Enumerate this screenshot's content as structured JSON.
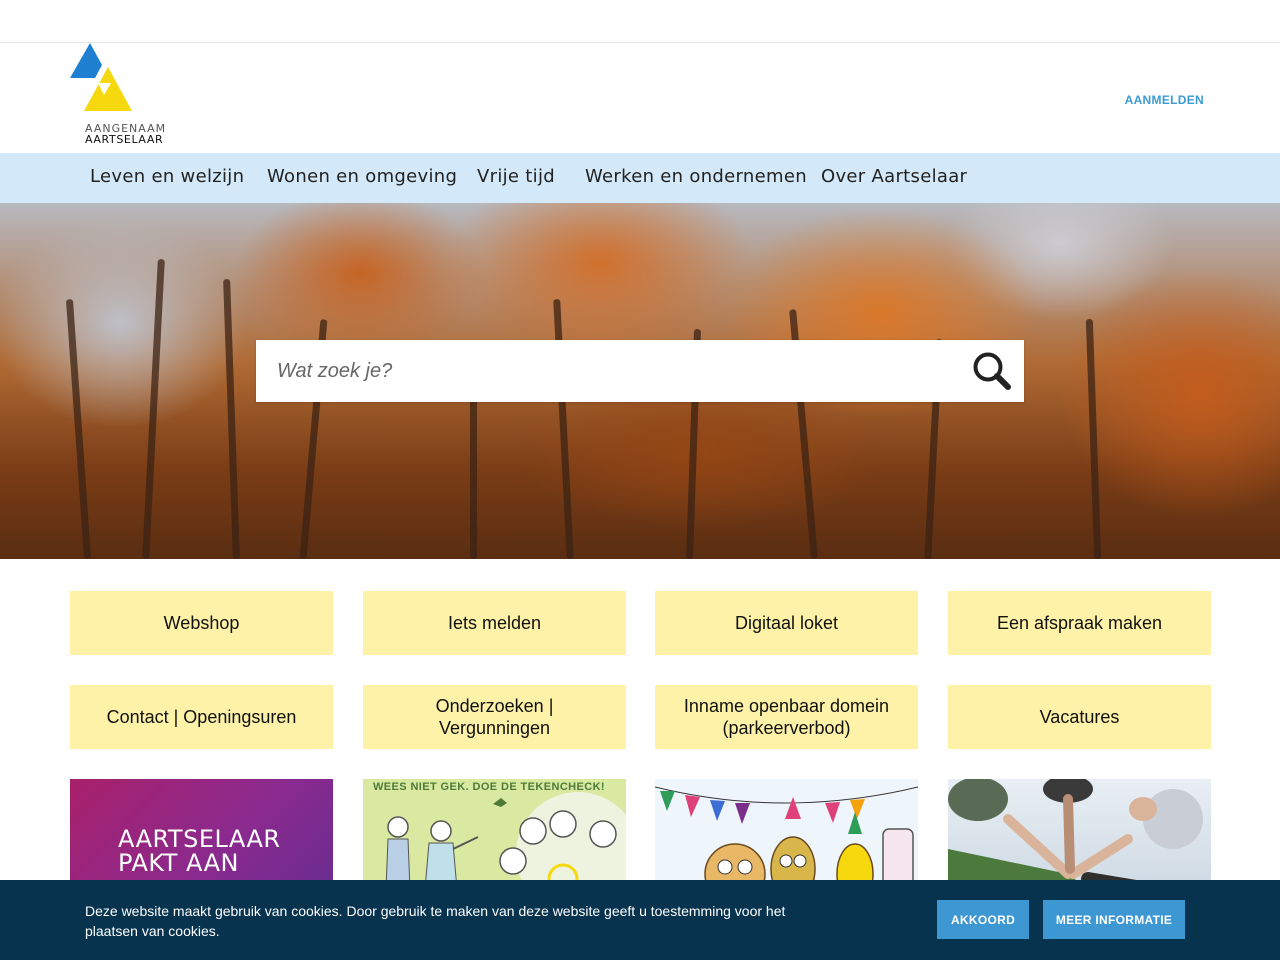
{
  "header": {
    "logo_line1": "AANGENAAM",
    "logo_line2": "AARTSELAAR",
    "login_label": "AANMELDEN"
  },
  "nav": {
    "items": [
      {
        "label": "Leven en welzijn"
      },
      {
        "label": "Wonen en omgeving"
      },
      {
        "label": "Vrije tijd"
      },
      {
        "label": "Werken en ondernemen"
      },
      {
        "label": "Over Aartselaar"
      }
    ]
  },
  "search": {
    "placeholder": "Wat zoek je?",
    "value": "",
    "icon": "search-icon"
  },
  "tiles": [
    {
      "label": "Webshop"
    },
    {
      "label": "Iets melden"
    },
    {
      "label": "Digitaal loket"
    },
    {
      "label": "Een afspraak maken"
    },
    {
      "label": "Contact | Openingsuren"
    },
    {
      "label": "Onderzoeken | Vergunningen"
    },
    {
      "label": "Inname openbaar domein (parkeerverbod)"
    },
    {
      "label": "Vacatures"
    }
  ],
  "promos": [
    {
      "text": "AARTSELAAR PAKT AAN"
    },
    {
      "text": "WEES NIET GEK. DOE DE TEKENCHECK!"
    },
    {
      "text": ""
    },
    {
      "text": ""
    }
  ],
  "cookie": {
    "text": "Deze website maakt gebruik van cookies. Door gebruik te maken van deze website geeft u toestemming voor het plaatsen van cookies.",
    "accept_label": "AKKOORD",
    "more_label": "MEER INFORMATIE"
  },
  "colors": {
    "nav_bg": "#d3e8f9",
    "tile_bg": "#fdf2a7",
    "cookie_bg": "#07334f",
    "button_bg": "#3c97d3",
    "link": "#3b9bd6",
    "logo_blue": "#1f7fd1",
    "logo_yellow": "#f5d90e"
  }
}
